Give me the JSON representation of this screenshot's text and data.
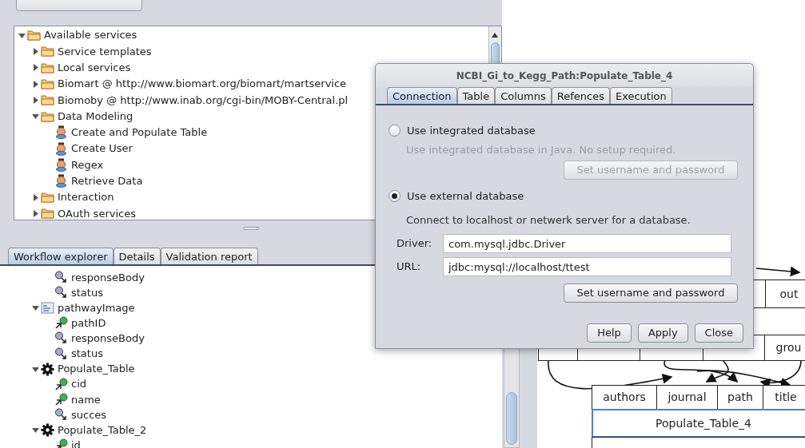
{
  "service_tree": [
    {
      "label": "Available services",
      "kind": "folder",
      "expanded": true,
      "children": [
        {
          "label": "Service templates",
          "kind": "folder",
          "expanded": false
        },
        {
          "label": "Local services",
          "kind": "folder",
          "expanded": false
        },
        {
          "label": "Biomart @ http://www.biomart.org/biomart/martservice",
          "kind": "folder",
          "expanded": false
        },
        {
          "label": "Biomoby @ http://www.inab.org/cgi-bin/MOBY-Central.pl",
          "kind": "folder",
          "expanded": false
        },
        {
          "label": "Data Modeling",
          "kind": "folder",
          "expanded": true,
          "children": [
            {
              "label": "Create and Populate Table",
              "kind": "service"
            },
            {
              "label": "Create User",
              "kind": "service"
            },
            {
              "label": "Regex",
              "kind": "service"
            },
            {
              "label": "Retrieve Data",
              "kind": "service"
            }
          ]
        },
        {
          "label": "Interaction",
          "kind": "folder",
          "expanded": false
        },
        {
          "label": "OAuth services",
          "kind": "folder",
          "expanded": false
        }
      ]
    }
  ],
  "panel_tabs": [
    {
      "label": "Workflow explorer",
      "selected": true
    },
    {
      "label": "Details",
      "selected": false
    },
    {
      "label": "Validation report",
      "selected": false
    }
  ],
  "workflow_tree": [
    {
      "label": "responseBody",
      "kind": "output"
    },
    {
      "label": "status",
      "kind": "output"
    },
    {
      "label": "pathwayImage",
      "kind": "rest",
      "expanded": true,
      "children": [
        {
          "label": "pathID",
          "kind": "input"
        },
        {
          "label": "responseBody",
          "kind": "output"
        },
        {
          "label": "status",
          "kind": "output"
        }
      ]
    },
    {
      "label": "Populate_Table",
      "kind": "processor",
      "expanded": true,
      "children": [
        {
          "label": "cid",
          "kind": "input"
        },
        {
          "label": "name",
          "kind": "input"
        },
        {
          "label": "succes",
          "kind": "output"
        }
      ]
    },
    {
      "label": "Populate_Table_2",
      "kind": "processor",
      "expanded": true,
      "children": [
        {
          "label": "id",
          "kind": "input"
        }
      ]
    }
  ],
  "diagram": {
    "out_port": "out",
    "group_ports": [
      "grou"
    ],
    "input_ports": [
      "authors",
      "journal",
      "path",
      "title"
    ],
    "selected_node": "Populate_Table_4"
  },
  "dialog": {
    "title": "NCBI_Gi_to_Kegg_Path:Populate_Table_4",
    "tabs": [
      {
        "label": "Connection",
        "selected": true
      },
      {
        "label": "Table",
        "selected": false
      },
      {
        "label": "Columns",
        "selected": false
      },
      {
        "label": "Refences",
        "selected": false
      },
      {
        "label": "Execution",
        "selected": false
      }
    ],
    "options": [
      {
        "label": "Use integrated database",
        "selected": false,
        "disabled": true,
        "description": "Use integrated database in Java. No setup required.",
        "button": "Set username and password"
      },
      {
        "label": "Use external database",
        "selected": true,
        "disabled": false,
        "description": "Connect to localhost or netwerk server for a database.",
        "fields": [
          {
            "label": "Driver:",
            "value": "com.mysql.jdbc.Driver"
          },
          {
            "label": "URL:",
            "value": "jdbc:mysql://localhost/ttest"
          }
        ],
        "button": "Set username and password"
      }
    ],
    "buttons": [
      "Help",
      "Apply",
      "Close"
    ]
  }
}
